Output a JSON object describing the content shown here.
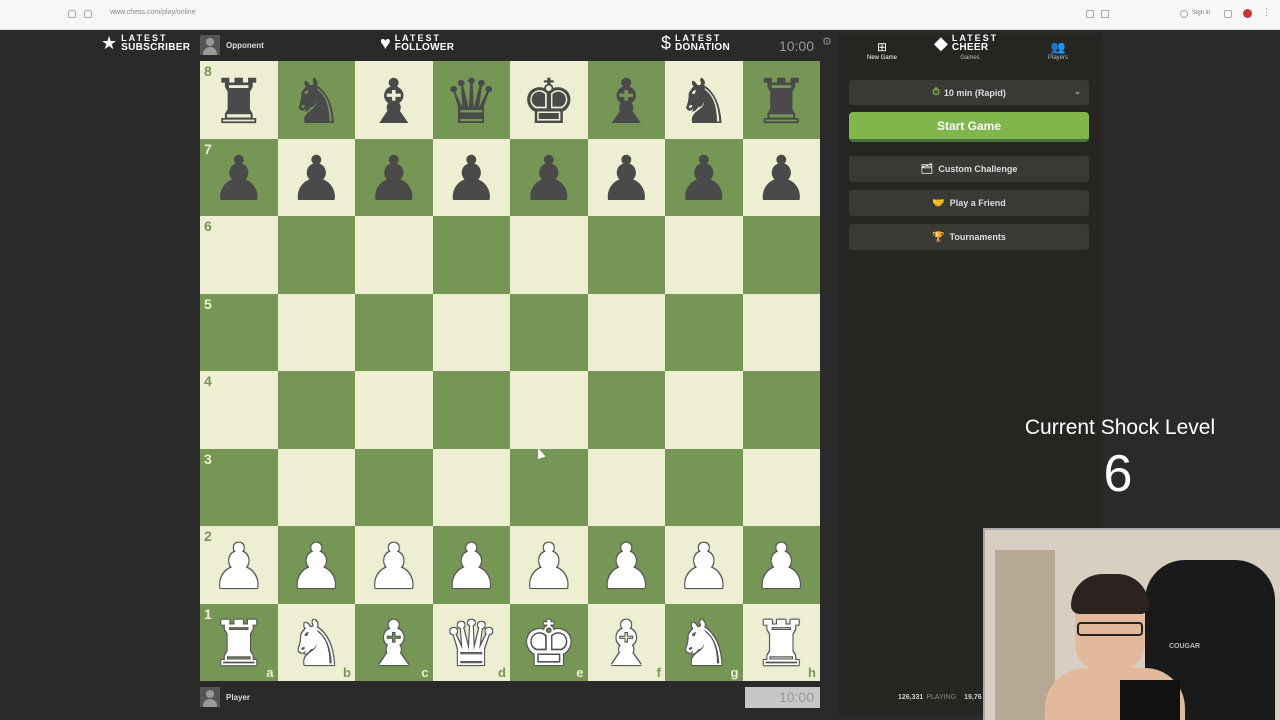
{
  "browser": {
    "url": "www.chess.com/play/online",
    "signin_label": "Sign in"
  },
  "overlay": {
    "subscriber": {
      "line1": "LATEST",
      "line2": "SUBSCRIBER",
      "icon": "star-icon"
    },
    "follower": {
      "line1": "LATEST",
      "line2": "FOLLOWER",
      "icon": "heart-icon"
    },
    "donation": {
      "line1": "LATEST",
      "line2": "DONATION",
      "icon": "dollar-icon"
    },
    "cheer": {
      "line1": "LATEST",
      "line2": "CHEER",
      "icon": "diamond-icon"
    }
  },
  "game": {
    "opponent_name": "Opponent",
    "player_name": "Player",
    "opponent_clock": "10:00",
    "player_clock": "10:00"
  },
  "board": {
    "ranks": [
      "8",
      "7",
      "6",
      "5",
      "4",
      "3",
      "2",
      "1"
    ],
    "files": [
      "a",
      "b",
      "c",
      "d",
      "e",
      "f",
      "g",
      "h"
    ],
    "position": [
      [
        "♜",
        "♞",
        "♝",
        "♛",
        "♚",
        "♝",
        "♞",
        "♜"
      ],
      [
        "♟",
        "♟",
        "♟",
        "♟",
        "♟",
        "♟",
        "♟",
        "♟"
      ],
      [
        "",
        "",
        "",
        "",
        "",
        "",
        "",
        ""
      ],
      [
        "",
        "",
        "",
        "",
        "",
        "",
        "",
        ""
      ],
      [
        "",
        "",
        "",
        "",
        "",
        "",
        "",
        ""
      ],
      [
        "",
        "",
        "",
        "",
        "",
        "",
        "",
        ""
      ],
      [
        "♟",
        "♟",
        "♟",
        "♟",
        "♟",
        "♟",
        "♟",
        "♟"
      ],
      [
        "♜",
        "♞",
        "♝",
        "♛",
        "♚",
        "♝",
        "♞",
        "♜"
      ]
    ],
    "colors": [
      "black",
      "black",
      "",
      "",
      "",
      "",
      "white",
      "white"
    ]
  },
  "panel": {
    "tabs": [
      {
        "label": "New Game",
        "icon": "plus-square-icon"
      },
      {
        "label": "Games",
        "icon": "games-icon"
      },
      {
        "label": "Players",
        "icon": "players-icon"
      }
    ],
    "time_control": "10 min (Rapid)",
    "start_button": "Start Game",
    "menu": [
      {
        "label": "Custom Challenge",
        "icon": "challenge-icon"
      },
      {
        "label": "Play a Friend",
        "icon": "handshake-icon"
      },
      {
        "label": "Tournaments",
        "icon": "trophy-icon"
      }
    ],
    "stats": {
      "playing_count": "126,331",
      "playing_label": "PLAYING",
      "games_count": "19,76"
    }
  },
  "shock": {
    "title": "Current Shock Level",
    "level": "6"
  },
  "webcam": {
    "chair_label": "COUGAR"
  },
  "colors": {
    "board_light": "#eeeed2",
    "board_dark": "#769656",
    "start_green": "#81b64c",
    "panel_bg": "#262522"
  }
}
